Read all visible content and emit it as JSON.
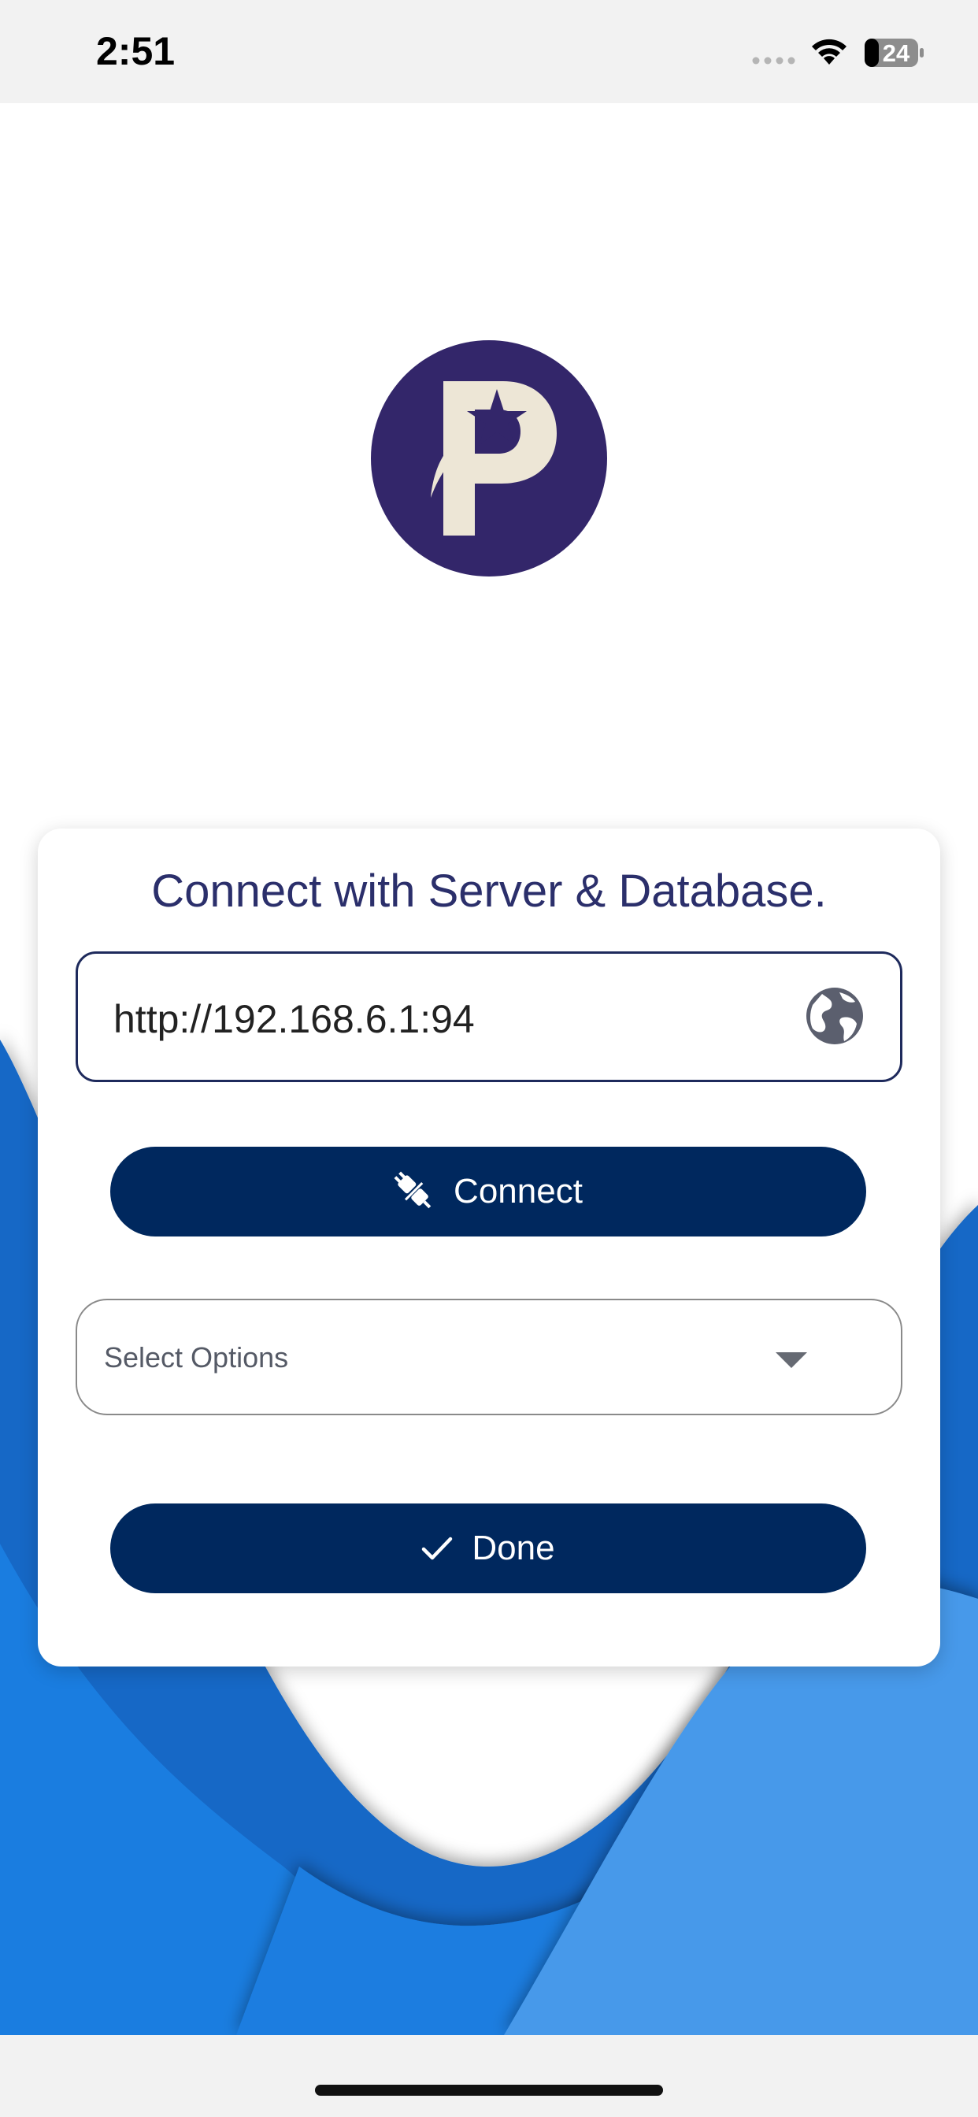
{
  "status_bar": {
    "time": "2:51",
    "battery_level": "24",
    "icons": [
      "signal-dots-icon",
      "wifi-icon",
      "battery-icon"
    ]
  },
  "logo": {
    "letter": "P",
    "background_color": "#33266a",
    "foreground_color": "#ede6d6"
  },
  "card": {
    "title": "Connect with Server & Database.",
    "url_field": {
      "value": "http://192.168.6.1:94",
      "icon": "globe-icon"
    },
    "connect_button": {
      "label": "Connect",
      "icon": "plug-icon"
    },
    "select": {
      "placeholder": "Select Options",
      "icon": "chevron-down-icon"
    },
    "done_button": {
      "label": "Done",
      "icon": "checkmark-icon"
    }
  },
  "colors": {
    "primary_button": "#00285e",
    "title_text": "#2b2f6b",
    "wave_dark": "#1668c6",
    "wave_mid": "#1a7de0",
    "wave_light": "#4799ea"
  }
}
